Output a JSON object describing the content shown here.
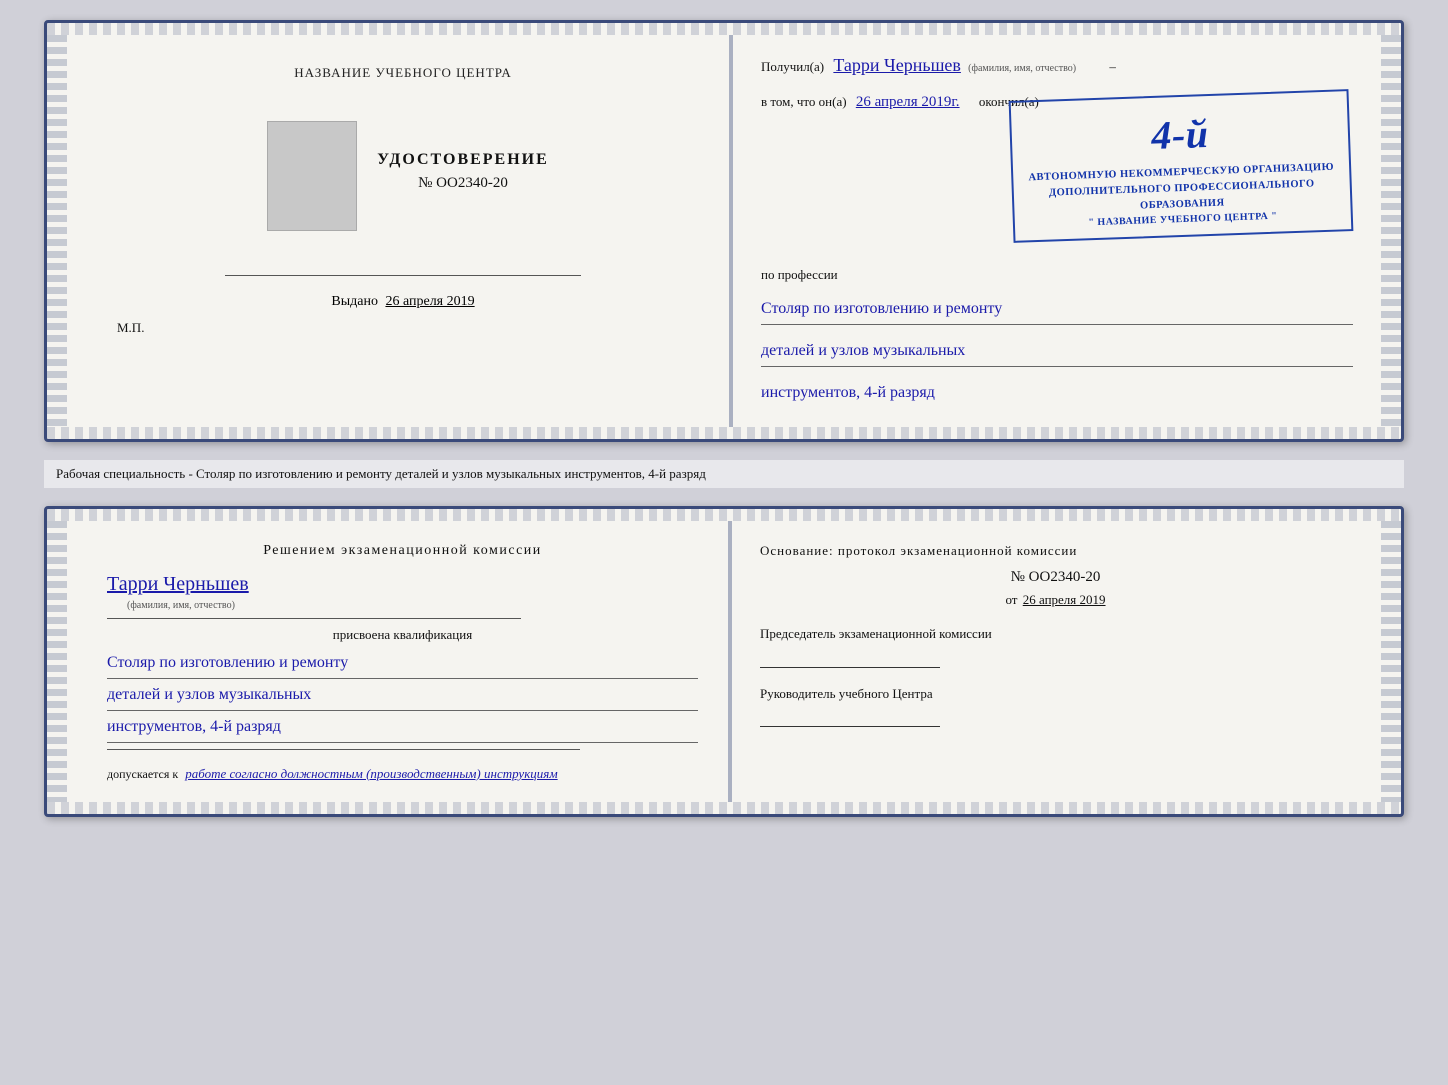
{
  "doc1": {
    "left": {
      "title": "НАЗВАНИЕ УЧЕБНОГО ЦЕНТРА",
      "udostoverenie": "УДОСТОВЕРЕНИЕ",
      "number": "№ OO2340-20",
      "vydano_label": "Выдано",
      "vydano_date": "26 апреля 2019",
      "mp": "М.П."
    },
    "right": {
      "poluchil_prefix": "Получил(а)",
      "name_handwritten": "Тарри Черньшев",
      "name_subtitle": "(фамилия, имя, отчество)",
      "v_tom_prefix": "в том, что он(а)",
      "date_handwritten": "26 апреля 2019г.",
      "okonchil": "окончил(а)",
      "stamp_line1": "4-й",
      "stamp_line2": "АВТОНОМНУЮ НЕКОММЕРЧЕСКУЮ ОРГАНИЗАЦИЮ",
      "stamp_line3": "ДОПОЛНИТЕЛЬНОГО ПРОФЕССИОНАЛЬНОГО ОБРАЗОВАНИЯ",
      "stamp_line4": "\" НАЗВАНИЕ УЧЕБНОГО ЦЕНТРА \"",
      "po_professii": "по профессии",
      "profession1": "Столяр по изготовлению и ремонту",
      "profession2": "деталей и узлов музыкальных",
      "profession3": "инструментов, 4-й разряд"
    }
  },
  "subtitle": "Рабочая специальность - Столяр по изготовлению и ремонту деталей и узлов музыкальных инструментов, 4-й разряд",
  "doc2": {
    "left": {
      "resheniye": "Решением  экзаменационной  комиссии",
      "name_handwritten": "Тарри Черньшев",
      "name_subtitle": "(фамилия, имя, отчество)",
      "prisvoena": "присвоена квалификация",
      "profession1": "Столяр по изготовлению и ремонту",
      "profession2": "деталей и узлов музыкальных",
      "profession3": "инструментов, 4-й разряд",
      "dopuskaetsya_prefix": "допускается к",
      "dopuskaetsya_text": "работе согласно должностным (производственным) инструкциям"
    },
    "right": {
      "osnovanie": "Основание: протокол экзаменационной  комиссии",
      "number": "№  OO2340-20",
      "ot_prefix": "от",
      "ot_date": "26 апреля 2019",
      "predsedatel_label": "Председатель экзаменационной комиссии",
      "rukovoditel_label": "Руководитель учебного Центра"
    }
  }
}
